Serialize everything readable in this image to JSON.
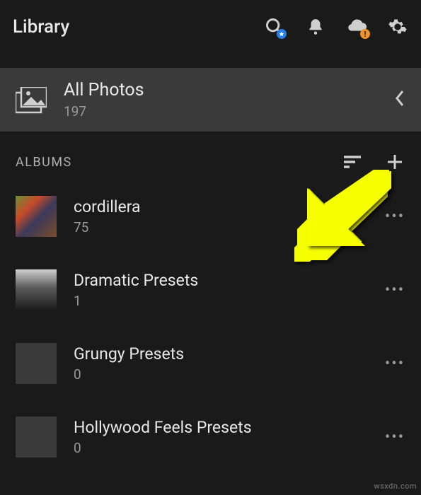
{
  "header": {
    "title": "Library"
  },
  "allPhotos": {
    "title": "All Photos",
    "count": "197"
  },
  "section": {
    "label": "ALBUMS"
  },
  "albums": [
    {
      "title": "cordillera",
      "count": "75"
    },
    {
      "title": "Dramatic Presets",
      "count": "1"
    },
    {
      "title": "Grungy Presets",
      "count": "0"
    },
    {
      "title": "Hollywood Feels Presets",
      "count": "0"
    }
  ],
  "watermark": "wsxdn.com"
}
